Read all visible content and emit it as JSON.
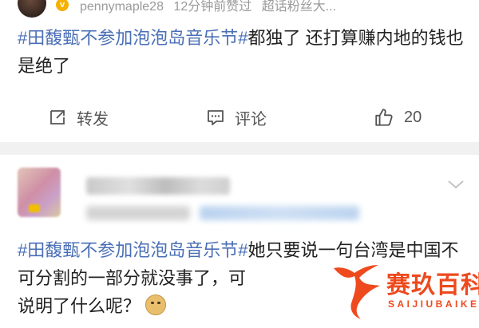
{
  "post1": {
    "username": "pennymaple28",
    "time": "12分钟前赞过",
    "extra": "超话粉丝大...",
    "verified_badge": "v",
    "hashtag": "#田馥甄不参加泡泡岛音乐节#",
    "text": "都独了 还打算赚内地的钱也是绝了",
    "actions": {
      "repost_label": "转发",
      "comment_label": "评论",
      "like_count": "20"
    }
  },
  "post2": {
    "hashtag": "#田馥甄不参加泡泡岛音乐节#",
    "text": "她只要说一句台湾是中国不可分割的一部分就没事了，可",
    "text2": "说明了什么呢？"
  },
  "watermark": {
    "title": "赛玖百科",
    "subtitle": "SAIJIUBAIKE",
    "color": "#ee4a1e"
  },
  "colors": {
    "hashtag": "#4a6fb6",
    "text": "#222222",
    "muted": "#9a9a9a",
    "separator": "#f1f1f1"
  }
}
